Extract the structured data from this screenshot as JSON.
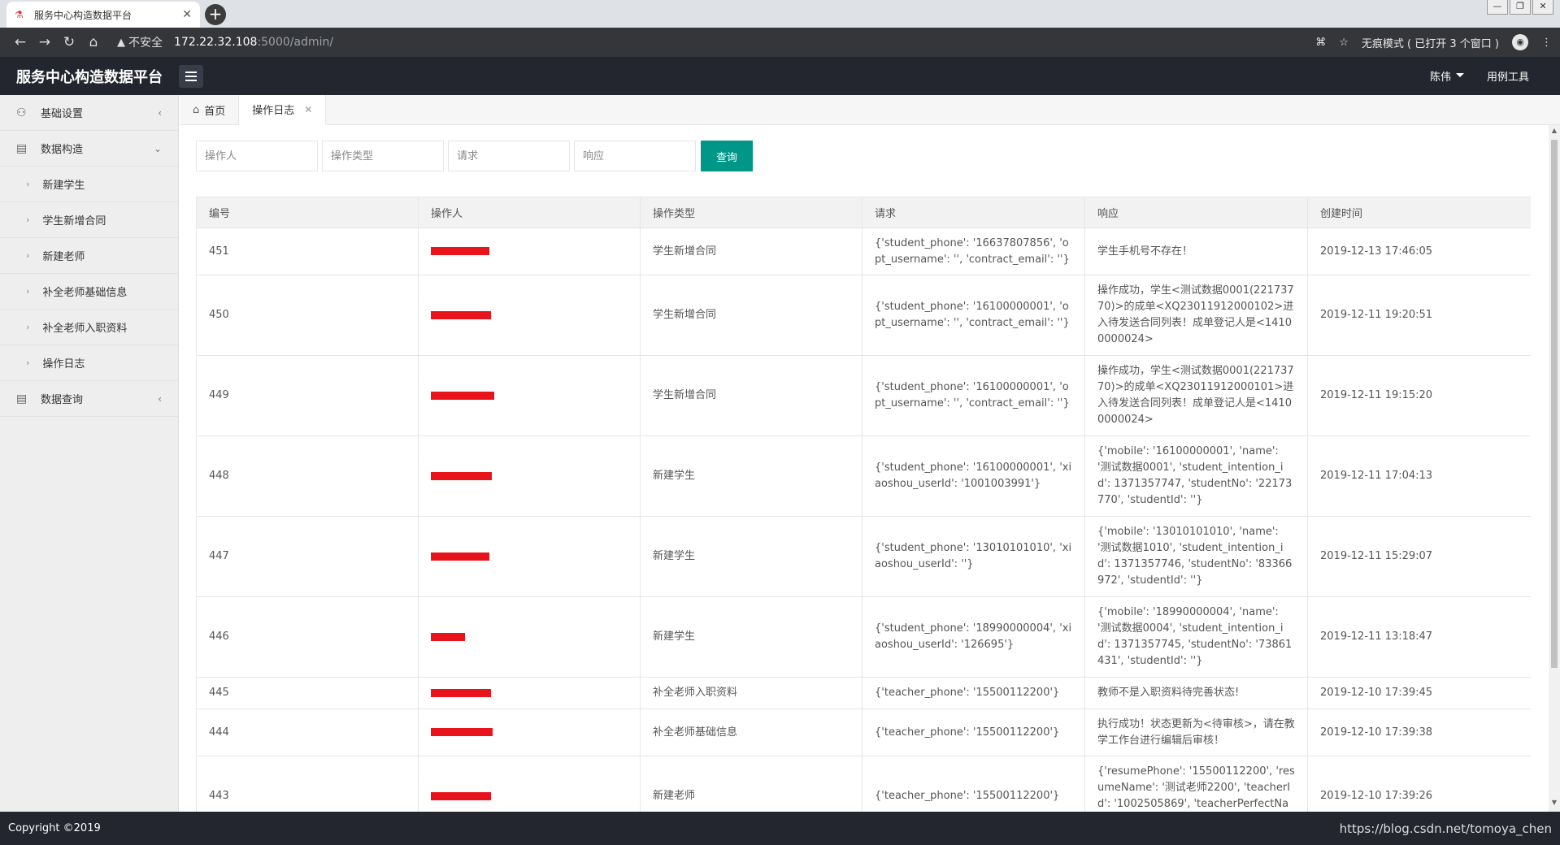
{
  "browser": {
    "tab_title": "服务中心构造数据平台",
    "url_warning": "不安全",
    "url_host": "172.22.32.108",
    "url_path": ":5000/admin/",
    "incognito_label": "无痕模式 ( 已打开 3 个窗口 )"
  },
  "header": {
    "brand": "服务中心构造数据平台",
    "user": "陈伟",
    "tool": "用例工具"
  },
  "sidebar": {
    "items": [
      {
        "label": "基础设置"
      },
      {
        "label": "数据构造"
      },
      {
        "label": "数据查询"
      }
    ],
    "subitems": [
      {
        "label": "新建学生"
      },
      {
        "label": "学生新增合同"
      },
      {
        "label": "新建老师"
      },
      {
        "label": "补全老师基础信息"
      },
      {
        "label": "补全老师入职资料"
      },
      {
        "label": "操作日志"
      }
    ]
  },
  "tabs": {
    "home": "首页",
    "active": "操作日志"
  },
  "filters": {
    "operator_ph": "操作人",
    "type_ph": "操作类型",
    "request_ph": "请求",
    "response_ph": "响应",
    "query_label": "查询"
  },
  "table": {
    "headers": [
      "编号",
      "操作人",
      "操作类型",
      "请求",
      "响应",
      "创建时间"
    ],
    "rows": [
      {
        "id": "451",
        "type": "学生新增合同",
        "request": "{'student_phone': '16637807856', 'opt_username': '', 'contract_email': ''}",
        "response": "学生手机号不存在！",
        "time": "2019-12-13 17:46:05"
      },
      {
        "id": "450",
        "type": "学生新增合同",
        "request": "{'student_phone': '16100000001', 'opt_username': '', 'contract_email': ''}",
        "response": "操作成功，学生<测试数据0001(22173770)>的成单<XQ23011912000102>进入待发送合同列表！成单登记人是<14100000024>",
        "time": "2019-12-11 19:20:51"
      },
      {
        "id": "449",
        "type": "学生新增合同",
        "request": "{'student_phone': '16100000001', 'opt_username': '', 'contract_email': ''}",
        "response": "操作成功，学生<测试数据0001(22173770)>的成单<XQ23011912000101>进入待发送合同列表！成单登记人是<14100000024>",
        "time": "2019-12-11 19:15:20"
      },
      {
        "id": "448",
        "type": "新建学生",
        "request": "{'student_phone': '16100000001', 'xiaoshou_userId': '1001003991'}",
        "response": "{'mobile': '16100000001', 'name': '测试数据0001', 'student_intention_id': 1371357747, 'studentNo': '22173770', 'studentId': ''}",
        "time": "2019-12-11 17:04:13"
      },
      {
        "id": "447",
        "type": "新建学生",
        "request": "{'student_phone': '13010101010', 'xiaoshou_userId': ''}",
        "response": "{'mobile': '13010101010', 'name': '测试数据1010', 'student_intention_id': 1371357746, 'studentNo': '83366972', 'studentId': ''}",
        "time": "2019-12-11 15:29:07"
      },
      {
        "id": "446",
        "type": "新建学生",
        "request": "{'student_phone': '18990000004', 'xiaoshou_userId': '126695'}",
        "response": "{'mobile': '18990000004', 'name': '测试数据0004', 'student_intention_id': 1371357745, 'studentNo': '73861431', 'studentId': ''}",
        "time": "2019-12-11 13:18:47"
      },
      {
        "id": "445",
        "type": "补全老师入职资料",
        "request": "{'teacher_phone': '15500112200'}",
        "response": "教师不是入职资料待完善状态!",
        "time": "2019-12-10 17:39:45"
      },
      {
        "id": "444",
        "type": "补全老师基础信息",
        "request": "{'teacher_phone': '15500112200'}",
        "response": "执行成功！状态更新为<待审核>，请在教学工作台进行编辑后审核！",
        "time": "2019-12-10 17:39:38"
      },
      {
        "id": "443",
        "type": "新建老师",
        "request": "{'teacher_phone': '15500112200'}",
        "response": "{'resumePhone': '15500112200', 'resumeName': '测试老师2200', 'teacherId': '1002505869', 'teacherPerfectName':",
        "time": "2019-12-10 17:39:26"
      }
    ]
  },
  "footer": {
    "copyright": "Copyright ©2019",
    "watermark": "https://blog.csdn.net/tomoya_chen"
  }
}
